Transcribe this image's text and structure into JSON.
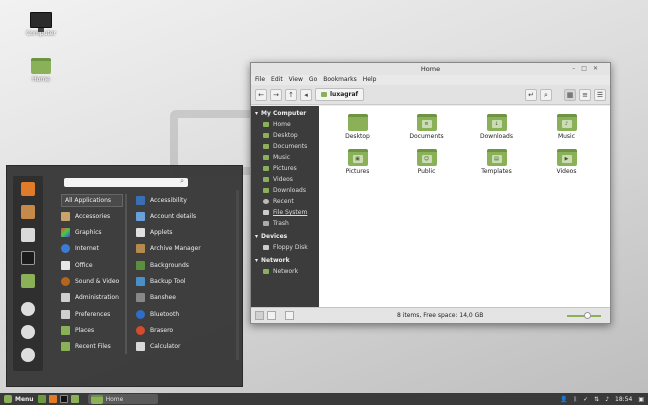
{
  "desktop": {
    "icons": [
      {
        "label": "Computer",
        "icon": "computer-icon"
      },
      {
        "label": "Home",
        "icon": "home-folder-icon"
      }
    ]
  },
  "file_manager": {
    "title": "Home",
    "window_controls": [
      "minimize",
      "maximize",
      "close"
    ],
    "menu": [
      "File",
      "Edit",
      "View",
      "Go",
      "Bookmarks",
      "Help"
    ],
    "breadcrumb": "luxagraf",
    "sidebar": {
      "sections": [
        {
          "title": "My Computer",
          "items": [
            "Home",
            "Desktop",
            "Documents",
            "Music",
            "Pictures",
            "Videos",
            "Downloads",
            "Recent",
            "File System",
            "Trash"
          ]
        },
        {
          "title": "Devices",
          "items": [
            "Floppy Disk"
          ]
        },
        {
          "title": "Network",
          "items": [
            "Network"
          ]
        }
      ]
    },
    "files": [
      "Desktop",
      "Documents",
      "Downloads",
      "Music",
      "Pictures",
      "Public",
      "Templates",
      "Videos"
    ],
    "status": "8 items, Free space: 14,0 GB"
  },
  "start_menu": {
    "search_placeholder": "",
    "categories": [
      "All Applications",
      "Accessories",
      "Graphics",
      "Internet",
      "Office",
      "Sound & Video",
      "Administration",
      "Preferences",
      "Places",
      "Recent Files"
    ],
    "apps": [
      "Accessibility",
      "Account details",
      "Applets",
      "Archive Manager",
      "Backgrounds",
      "Backup Tool",
      "Banshee",
      "Bluetooth",
      "Brasero",
      "Calculator"
    ]
  },
  "panel": {
    "menu_label": "Menu",
    "task_label": "Home",
    "clock": "18:54"
  },
  "colors": {
    "accent": "#8bb158",
    "panel": "#3a3a3a",
    "menu_bg": "#373737"
  }
}
